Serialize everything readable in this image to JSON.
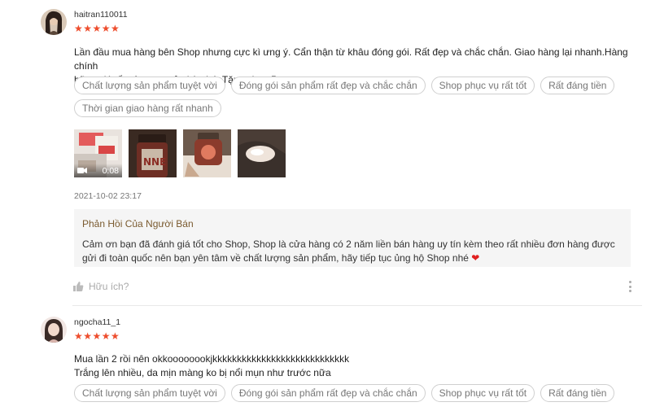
{
  "reviews": [
    {
      "username": "haitran110011",
      "stars": "★★★★★",
      "comment_lines": [
        "Lần đầu mua hàng bên Shop nhưng cực kì ưng ý. Cẩn thận từ khâu đóng gói. Rất đẹp và chắc chắn. Giao hàng lại nhanh.Hàng chính",
        "hãng giá tốt nên mua cả nhà nhé. Tặng shop 5 sao"
      ],
      "tags": [
        "Chất lượng sản phẩm tuyệt vời",
        "Đóng gói sản phẩm rất đẹp và chắc chắn",
        "Shop phục vụ rất tốt",
        "Rất đáng tiền",
        "Thời gian giao hàng rất nhanh"
      ],
      "video_duration": "0:08",
      "timestamp": "2021-10-02 23:17",
      "seller_reply": {
        "title": "Phản Hồi Của Người Bán",
        "text": "Cảm ơn bạn đã đánh giá tốt cho Shop, Shop là cửa hàng có 2 năm liền bán hàng uy tín kèm theo rất nhiều đơn hàng được gửi đi toàn quốc nên bạn yên tâm về chất lượng sản phẩm, hãy tiếp tục ủng hộ Shop nhé"
      },
      "helpful_label": "Hữu ích?"
    },
    {
      "username": "ngocha11_1",
      "stars": "★★★★★",
      "comment_lines": [
        "Mua lần 2 rồi nên okkoooooookjkkkkkkkkkkkkkkkkkkkkkkkkkkkk",
        "Trắng lên nhiều, da mịn màng ko bị nổi mụn như trước nữa"
      ],
      "tags": [
        "Chất lượng sản phẩm tuyệt vời",
        "Đóng gói sản phẩm rất đẹp và chắc chắn",
        "Shop phục vụ rất tốt",
        "Rất đáng tiền"
      ]
    }
  ],
  "icons": {
    "star": "star-icon",
    "heart": "heart-icon",
    "thumbs_up": "thumbs-up-icon",
    "more": "more-vertical-icon",
    "camera": "video-camera-icon"
  },
  "colors": {
    "star": "#ee4d2d",
    "reply_title": "#7a5a2f",
    "reply_bg": "#f5f5f5",
    "heart": "#e02020"
  }
}
